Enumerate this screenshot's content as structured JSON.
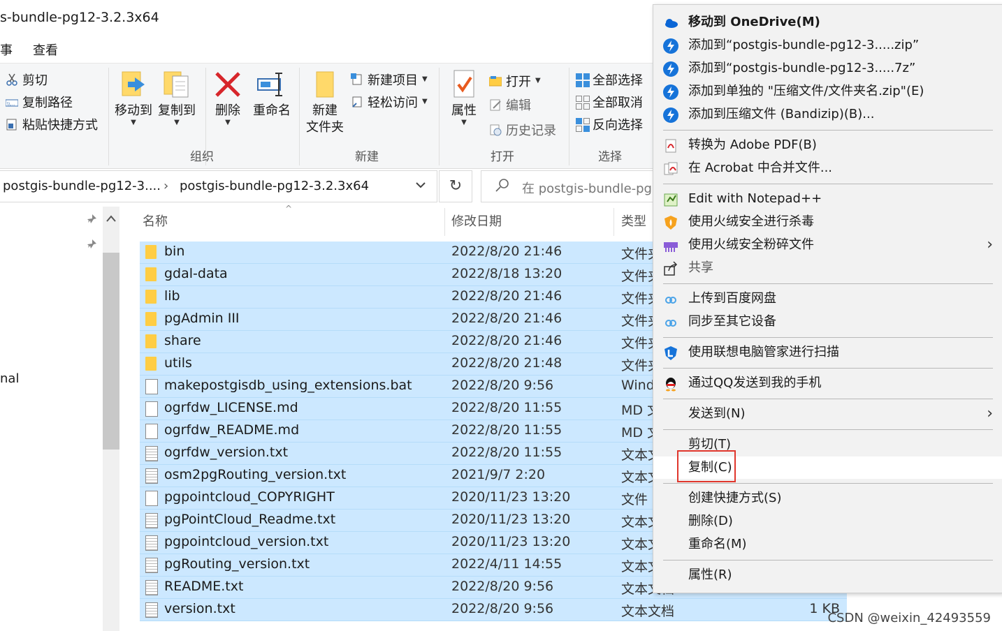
{
  "window": {
    "title": "s-bundle-pg12-3.2.3x64"
  },
  "menu": {
    "frag": "事",
    "view": "查看"
  },
  "ribbon": {
    "cut": "剪切",
    "copy_path": "复制路径",
    "paste_shortcut": "粘贴快捷方式",
    "move_to": "移动到",
    "copy_to": "复制到",
    "delete": "删除",
    "rename": "重命名",
    "new_folder_1": "新建",
    "new_folder_2": "文件夹",
    "new_item": "新建项目",
    "easy_access": "轻松访问",
    "properties": "属性",
    "open": "打开",
    "edit": "编辑",
    "history": "历史记录",
    "select_all": "全部选择",
    "select_none": "全部取消",
    "invert": "反向选择",
    "group_organize": "组织",
    "group_new": "新建",
    "group_open": "打开",
    "group_select": "选择"
  },
  "address": {
    "crumb1": "postgis-bundle-pg12-3....",
    "crumb2": "postgis-bundle-pg12-3.2.3x64",
    "search_placeholder": "在 postgis-bundle-pg"
  },
  "nav": {
    "frag": "nal"
  },
  "columns": {
    "name": "名称",
    "date": "修改日期",
    "type": "类型"
  },
  "files": [
    {
      "name": "bin",
      "date": "2022/8/20 21:46",
      "type": "文件夹",
      "size": "",
      "icon": "folder"
    },
    {
      "name": "gdal-data",
      "date": "2022/8/18 13:20",
      "type": "文件夹",
      "size": "",
      "icon": "folder"
    },
    {
      "name": "lib",
      "date": "2022/8/20 21:46",
      "type": "文件夹",
      "size": "",
      "icon": "folder"
    },
    {
      "name": "pgAdmin III",
      "date": "2022/8/20 21:46",
      "type": "文件夹",
      "size": "",
      "icon": "folder"
    },
    {
      "name": "share",
      "date": "2022/8/20 21:46",
      "type": "文件夹",
      "size": "",
      "icon": "folder"
    },
    {
      "name": "utils",
      "date": "2022/8/20 21:48",
      "type": "文件夹",
      "size": "",
      "icon": "folder"
    },
    {
      "name": "makepostgisdb_using_extensions.bat",
      "date": "2022/8/20 9:56",
      "type": "Wind",
      "size": "",
      "icon": "bat"
    },
    {
      "name": "ogrfdw_LICENSE.md",
      "date": "2022/8/20 11:55",
      "type": "MD 文",
      "size": "",
      "icon": "file"
    },
    {
      "name": "ogrfdw_README.md",
      "date": "2022/8/20 11:55",
      "type": "MD 文",
      "size": "",
      "icon": "file"
    },
    {
      "name": "ogrfdw_version.txt",
      "date": "2022/8/20 11:55",
      "type": "文本文",
      "size": "",
      "icon": "txt"
    },
    {
      "name": "osm2pgRouting_version.txt",
      "date": "2021/9/7 2:20",
      "type": "文本文",
      "size": "",
      "icon": "txt"
    },
    {
      "name": "pgpointcloud_COPYRIGHT",
      "date": "2020/11/23 13:20",
      "type": "文件",
      "size": "",
      "icon": "file"
    },
    {
      "name": "pgPointCloud_Readme.txt",
      "date": "2020/11/23 13:20",
      "type": "文本文",
      "size": "",
      "icon": "txt"
    },
    {
      "name": "pgpointcloud_version.txt",
      "date": "2020/11/23 13:20",
      "type": "文本文",
      "size": "",
      "icon": "txt"
    },
    {
      "name": "pgRouting_version.txt",
      "date": "2022/4/11 14:55",
      "type": "文本文",
      "size": "",
      "icon": "txt"
    },
    {
      "name": "README.txt",
      "date": "2022/8/20 9:56",
      "type": "文本文档",
      "size": "",
      "icon": "txt"
    },
    {
      "name": "version.txt",
      "date": "2022/8/20 9:56",
      "type": "文本文档",
      "size": "1 KB",
      "icon": "txt"
    }
  ],
  "context_menu": {
    "onedrive": "移动到 OneDrive(M)",
    "zip1": "添加到“postgis-bundle-pg12-3.....zip”",
    "zip2": "添加到“postgis-bundle-pg12-3.....7z”",
    "zip3": "添加到单独的 \"压缩文件/文件夹名.zip\"(E)",
    "zip4": "添加到压缩文件 (Bandizip)(B)...",
    "pdf": "转换为 Adobe PDF(B)",
    "acrobat": "在 Acrobat 中合并文件...",
    "notepad": "Edit with Notepad++",
    "huorong_scan": "使用火绒安全进行杀毒",
    "huorong_shred": "使用火绒安全粉碎文件",
    "share": "共享",
    "baidu": "上传到百度网盘",
    "sync": "同步至其它设备",
    "lenovo": "使用联想电脑管家进行扫描",
    "qq": "通过QQ发送到我的手机",
    "send_to": "发送到(N)",
    "cut": "剪切(T)",
    "copy": "复制(C)",
    "shortcut": "创建快捷方式(S)",
    "delete": "删除(D)",
    "rename": "重命名(M)",
    "properties": "属性(R)"
  },
  "watermark": "CSDN @weixin_42493559",
  "colors": {
    "selection": "#cce8ff",
    "highlight_box": "#e0362c",
    "folder": "#ffcd44",
    "accent_blue": "#0a66d6"
  }
}
